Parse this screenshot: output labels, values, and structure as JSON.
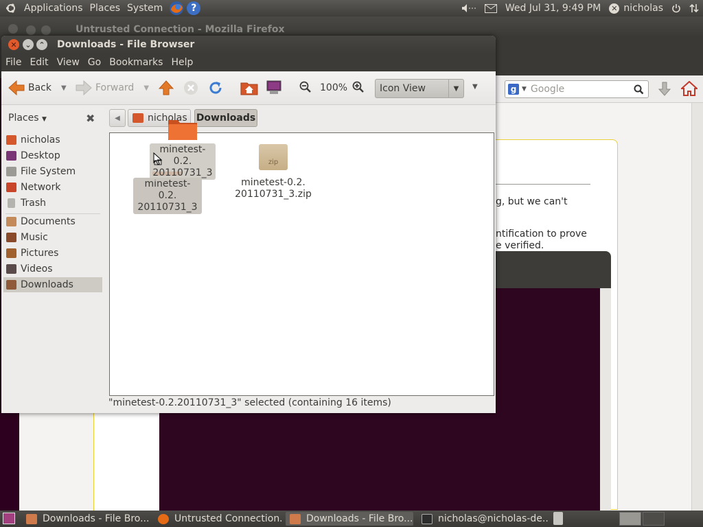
{
  "top_panel": {
    "menus": [
      "Applications",
      "Places",
      "System"
    ],
    "datetime": "Wed Jul 31,  9:49 PM",
    "user": "nicholas"
  },
  "firefox": {
    "title": "Untrusted Connection - Mozilla Firefox",
    "search_placeholder": "Google",
    "page_text_1": "g, but we can't",
    "page_text_2": "ntification to prove",
    "page_text_3": "e verified."
  },
  "file_browser": {
    "title": "Downloads - File Browser",
    "menus": [
      "File",
      "Edit",
      "View",
      "Go",
      "Bookmarks",
      "Help"
    ],
    "toolbar": {
      "back": "Back",
      "forward": "Forward",
      "zoom": "100%",
      "view_mode": "Icon View"
    },
    "sidebar": {
      "header": "Places",
      "items": [
        {
          "label": "nicholas",
          "icon": "home-folder-icon"
        },
        {
          "label": "Desktop",
          "icon": "desktop-icon"
        },
        {
          "label": "File System",
          "icon": "harddisk-icon"
        },
        {
          "label": "Network",
          "icon": "network-icon"
        },
        {
          "label": "Trash",
          "icon": "trash-icon"
        },
        {
          "label": "Documents",
          "icon": "folder-icon"
        },
        {
          "label": "Music",
          "icon": "folder-icon"
        },
        {
          "label": "Pictures",
          "icon": "folder-icon"
        },
        {
          "label": "Videos",
          "icon": "folder-icon"
        },
        {
          "label": "Downloads",
          "icon": "folder-icon",
          "selected": true
        }
      ]
    },
    "pathbar": {
      "home": "nicholas",
      "current": "Downloads"
    },
    "files": [
      {
        "name_line1": "minetest-0.2.",
        "name_line2": "20110731_3",
        "type": "folder",
        "selected": true
      },
      {
        "name_line1": "minetest-0.2.",
        "name_line2": "20110731_3.zip",
        "type": "zip",
        "icon_text": "zip"
      }
    ],
    "drag_ghost": {
      "name_line1": "minetest-0.2.",
      "name_line2": "20110731_3"
    },
    "status": "\"minetest-0.2.20110731_3\" selected (containing 16 items)"
  },
  "taskbar": {
    "tasks": [
      {
        "label": "Downloads - File Bro...",
        "active": false
      },
      {
        "label": "Untrusted Connection...",
        "active": false
      },
      {
        "label": "Downloads - File Bro...",
        "active": true
      },
      {
        "label": "nicholas@nicholas-de...",
        "active": false
      }
    ]
  }
}
